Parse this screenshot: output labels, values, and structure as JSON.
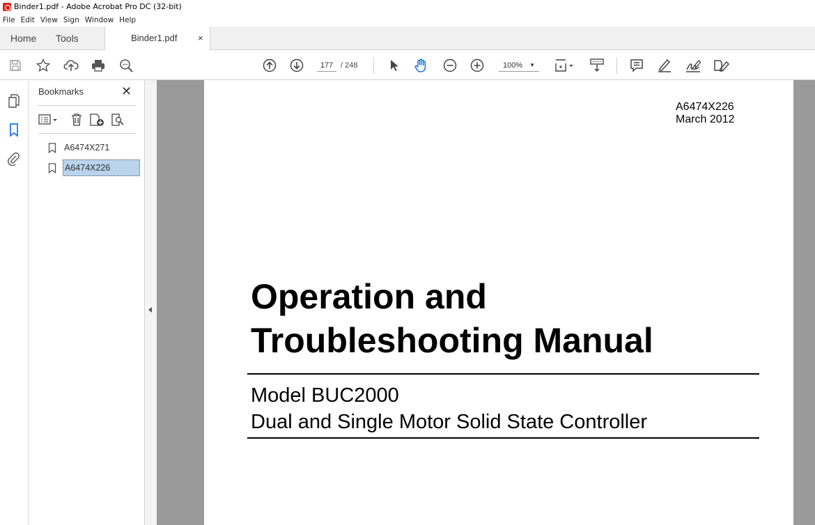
{
  "window": {
    "title": "Binder1.pdf - Adobe Acrobat Pro DC (32-bit)"
  },
  "menu": [
    "File",
    "Edit",
    "View",
    "Sign",
    "Window",
    "Help"
  ],
  "tabs": {
    "home": "Home",
    "tools": "Tools",
    "file": "Binder1.pdf",
    "close": "×"
  },
  "toolbar": {
    "icons": [
      "save-icon",
      "bookmark-star-icon",
      "upload-cloud-icon",
      "print-icon",
      "search-zoom-icon",
      "prev-page-icon",
      "next-page-icon",
      "select-arrow-icon",
      "hand-tool-icon",
      "zoom-out-icon",
      "zoom-in-icon",
      "page-fit-icon",
      "scroll-mode-icon",
      "comment-icon",
      "highlight-pen-icon",
      "sign-icon",
      "fill-sign-icon"
    ],
    "page_current": "177",
    "page_total": "/ 248",
    "zoom": "100%"
  },
  "bookmarks": {
    "title": "Bookmarks",
    "close": "✕",
    "items": [
      {
        "label": "A6474X271",
        "selected": false
      },
      {
        "label": "A6474X226",
        "selected": true
      }
    ]
  },
  "document": {
    "id": "A6474X226",
    "date": "March 2012",
    "title_line1": "Operation and",
    "title_line2": "Troubleshooting Manual",
    "model": "Model BUC2000",
    "description": "Dual and Single Motor Solid State Controller"
  },
  "colors": {
    "accent": "#1473e6",
    "selection": "#b9d4ec",
    "doc_bg": "#9a9a9a"
  }
}
